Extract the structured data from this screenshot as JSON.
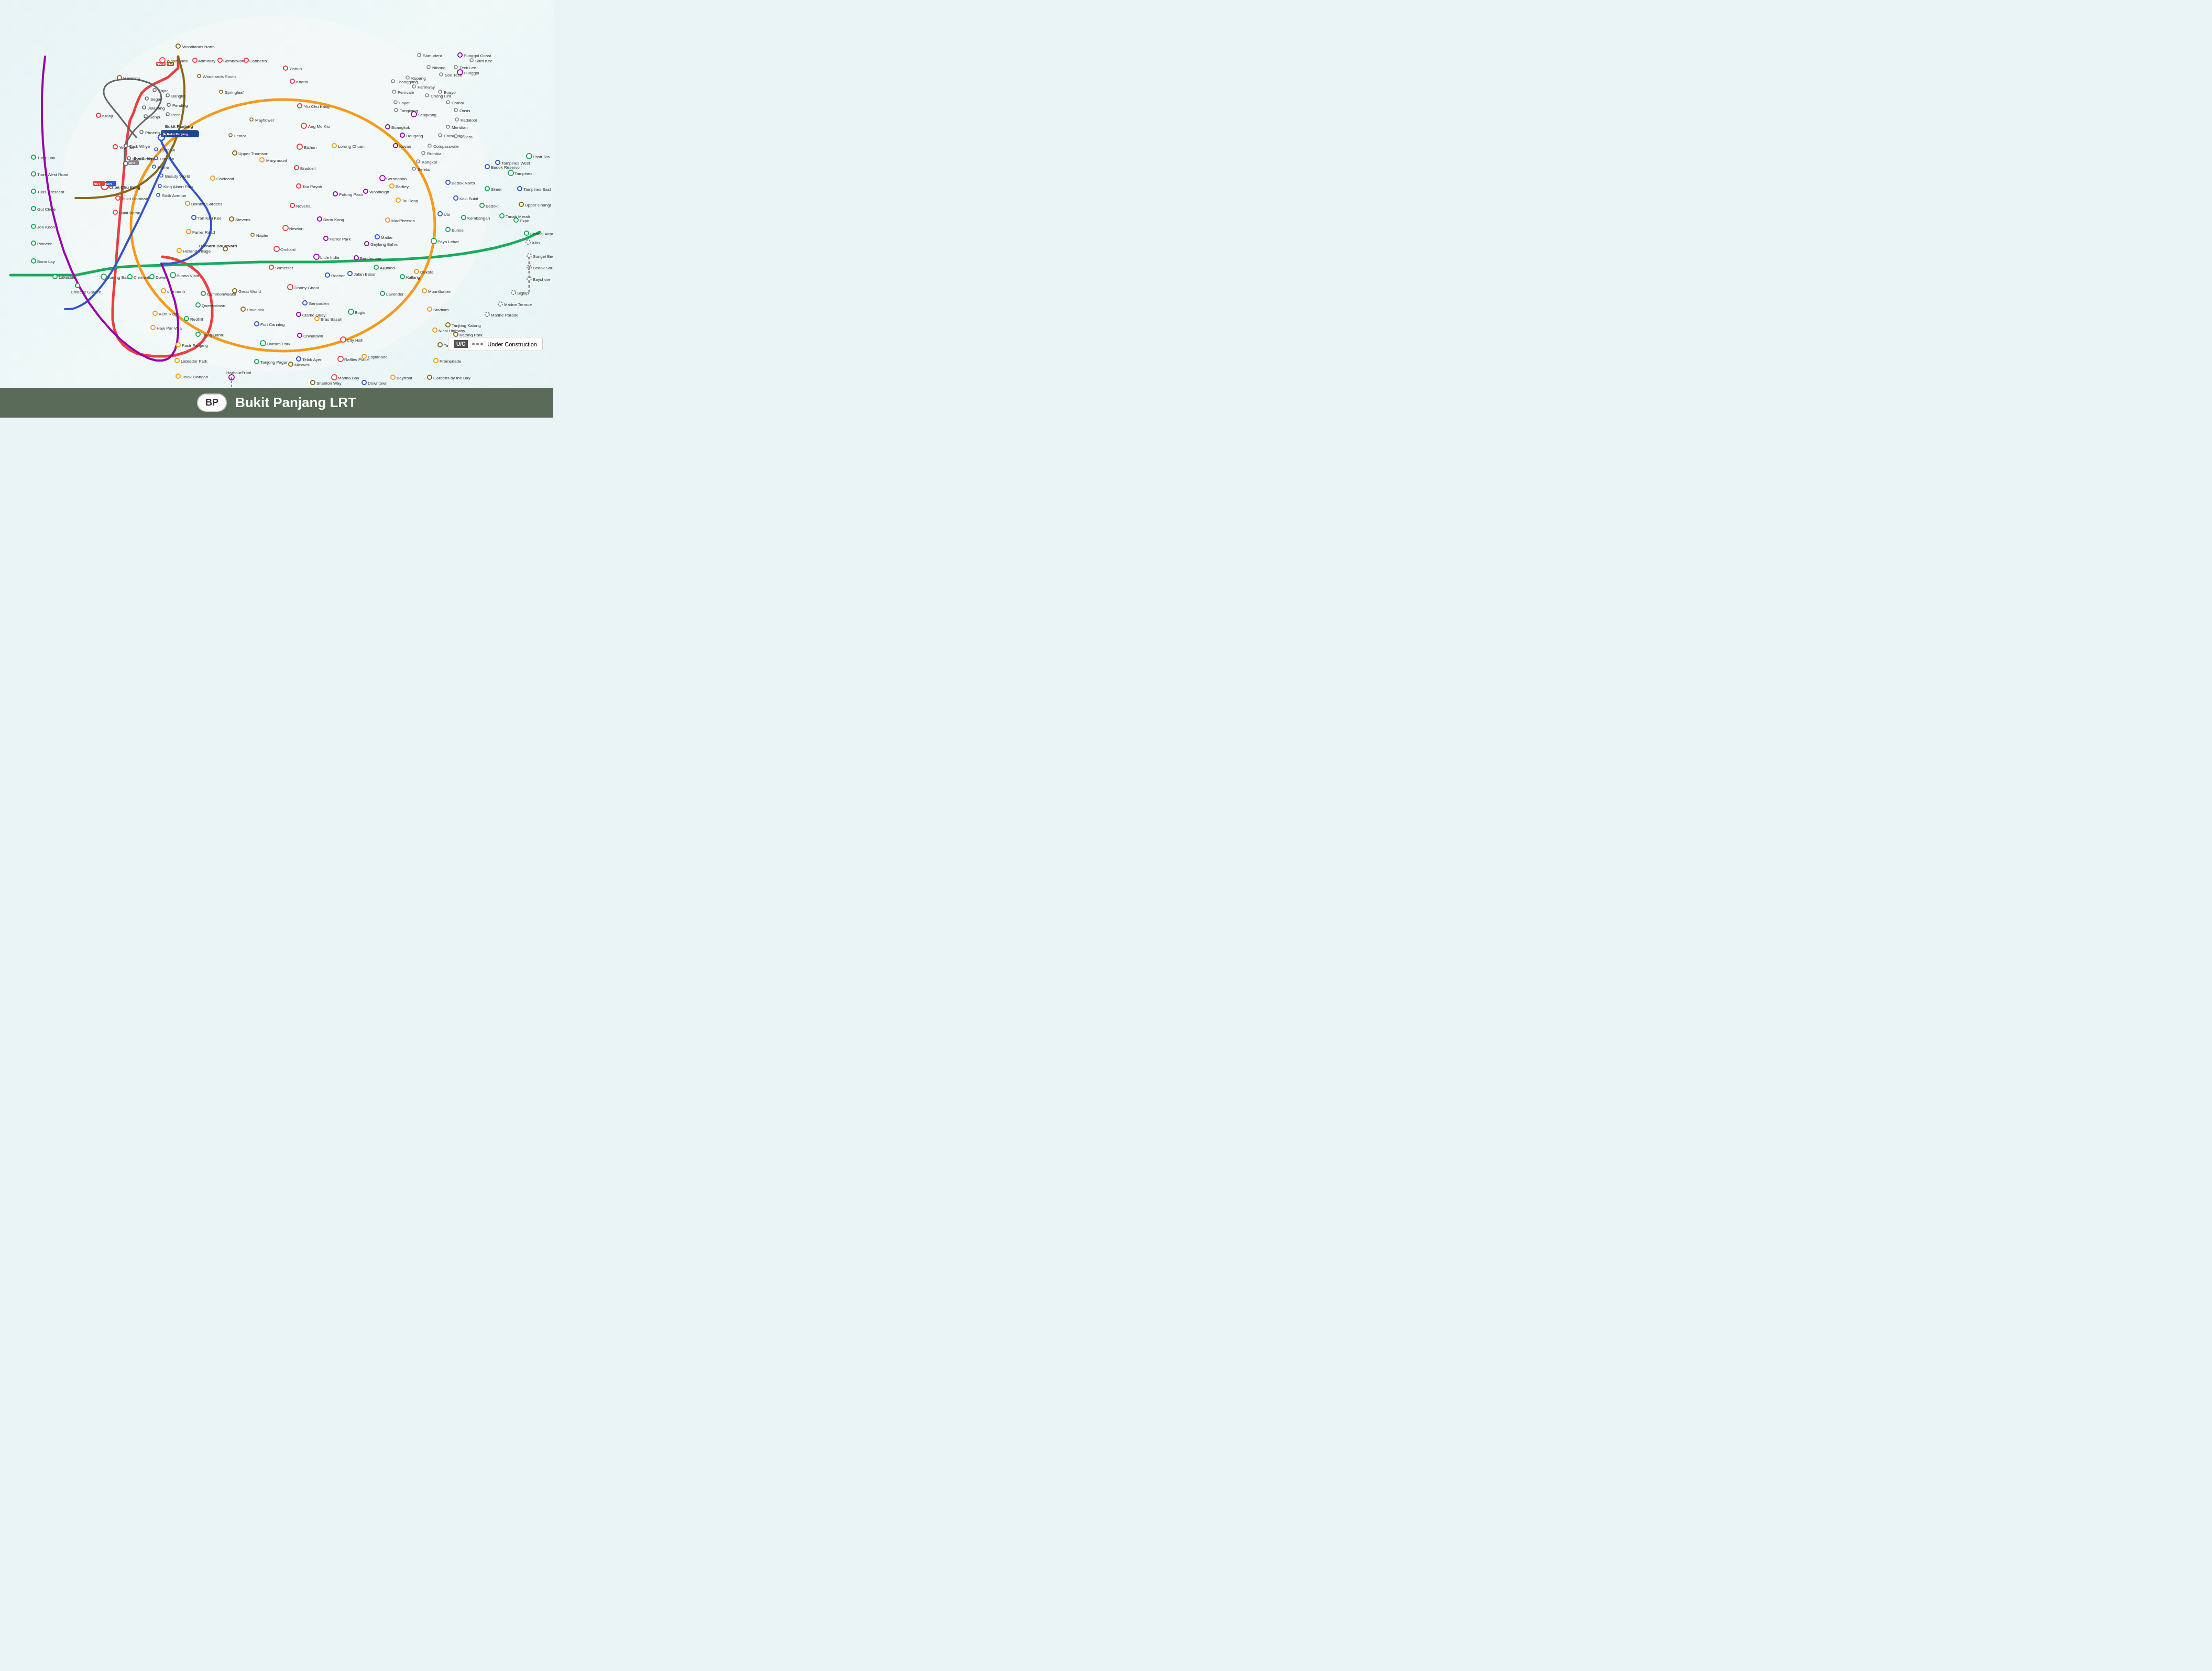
{
  "title": "Bukit Panjang LRT",
  "badge": "BP",
  "legend": {
    "uc_label": "U/C",
    "description": "Under Construction"
  },
  "map": {
    "highlighted_stations": [
      "Bukit Panjang",
      "South View",
      "Orchard Boulevard",
      "Choa Chu Kang"
    ]
  },
  "bottom_bar": {
    "badge_text": "BP",
    "title_text": "Bukit Panjang LRT"
  }
}
